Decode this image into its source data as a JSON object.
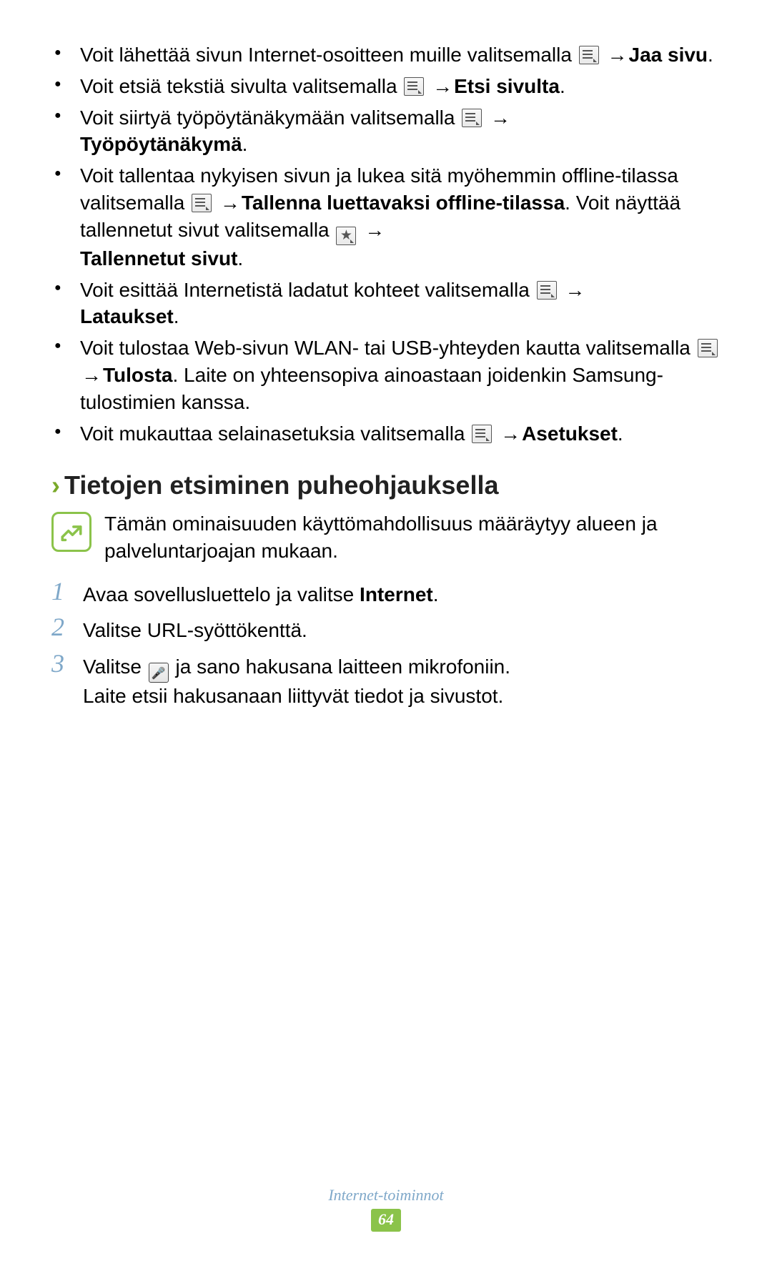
{
  "bullets": {
    "b1a": "Voit lähettää sivun Internet-osoitteen muille valitsemalla ",
    "b1b": " → ",
    "b1c": "Jaa sivu",
    "b1d": ".",
    "b2a": "Voit etsiä tekstiä sivulta valitsemalla ",
    "b2b": " → ",
    "b2c": "Etsi sivulta",
    "b2d": ".",
    "b3a": "Voit siirtyä työpöytänäkymään valitsemalla ",
    "b3b": " → ",
    "b3c": "Työpöytänäkymä",
    "b3d": ".",
    "b4a": "Voit tallentaa nykyisen sivun ja lukea sitä myöhemmin offline-tilassa valitsemalla ",
    "b4b": " → ",
    "b4c": "Tallenna luettavaksi offline-tilassa",
    "b4d": ". Voit näyttää tallennetut sivut valitsemalla ",
    "b4e": " → ",
    "b4f": "Tallennetut sivut",
    "b4g": ".",
    "b5a": "Voit esittää Internetistä ladatut kohteet valitsemalla ",
    "b5b": " → ",
    "b5c": "Lataukset",
    "b5d": ".",
    "b6a": "Voit tulostaa Web-sivun WLAN- tai USB-yhteyden kautta valitsemalla ",
    "b6b": " → ",
    "b6c": "Tulosta",
    "b6d": ". Laite on yhteensopiva ainoastaan joidenkin Samsung-tulostimien kanssa.",
    "b7a": "Voit mukauttaa selainasetuksia valitsemalla ",
    "b7b": " → ",
    "b7c": "Asetukset",
    "b7d": "."
  },
  "heading": {
    "chevron": "›",
    "text": "Tietojen etsiminen puheohjauksella"
  },
  "note": "Tämän ominaisuuden käyttömahdollisuus määräytyy alueen ja palveluntarjoajan mukaan.",
  "steps": {
    "n1": "1",
    "s1a": "Avaa sovellusluettelo ja valitse ",
    "s1b": "Internet",
    "s1c": ".",
    "n2": "2",
    "s2": "Valitse URL-syöttökenttä.",
    "n3": "3",
    "s3a": "Valitse ",
    "s3b": " ja sano hakusana laitteen mikrofoniin.",
    "s3c": "Laite etsii hakusanaan liittyvät tiedot ja sivustot."
  },
  "footer": {
    "section": "Internet-toiminnot",
    "page": "64"
  }
}
